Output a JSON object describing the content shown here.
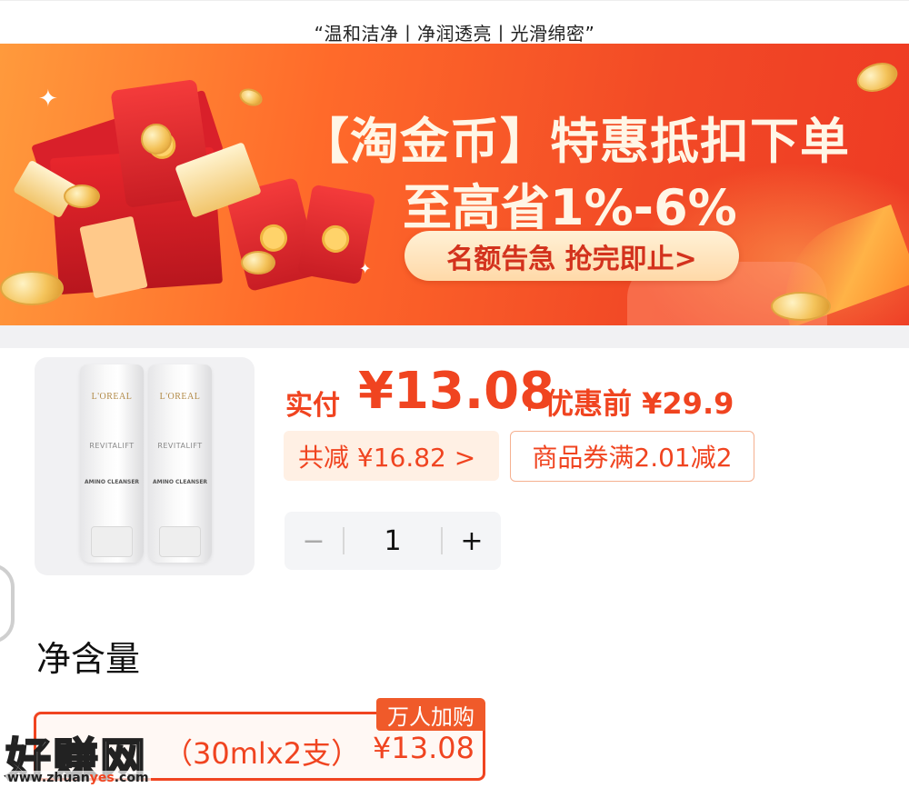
{
  "caption": {
    "text": "“温和洁净丨净润透亮丨光滑绵密”"
  },
  "banner": {
    "title_line1": "【淘金币】特惠抵扣下单",
    "title_line2": "至高省1%-6%",
    "cta": "名额告急 抢完即止>"
  },
  "product": {
    "image_alt": "L'OREAL REVITALIFT AMINO CLEANSER",
    "tube_brand": "L'OREAL",
    "tube_line": "REVITALIFT",
    "tube_sub": "AMINO CLEANSER",
    "price_paid_label": "实付",
    "price_paid": "¥13.08",
    "price_before": "优惠前 ¥29.9",
    "discount_tag": "共减 ¥16.82 >",
    "coupon_tag": "商品券满2.01减2"
  },
  "quantity": {
    "minus": "−",
    "value": "1",
    "plus": "+"
  },
  "section": {
    "title": "净含量"
  },
  "option": {
    "label": "（30mlx2支）",
    "price": "¥13.08",
    "badge": "万人加购"
  },
  "watermark": {
    "main": "好赚网",
    "url_prefix": "www.zhuan",
    "url_highlight": "yes",
    "url_suffix": ".com"
  },
  "colors": {
    "accent": "#f04420",
    "banner_start": "#ff9a3c",
    "banner_end": "#ee3a24",
    "pill_bg": "#ffe2b8"
  }
}
